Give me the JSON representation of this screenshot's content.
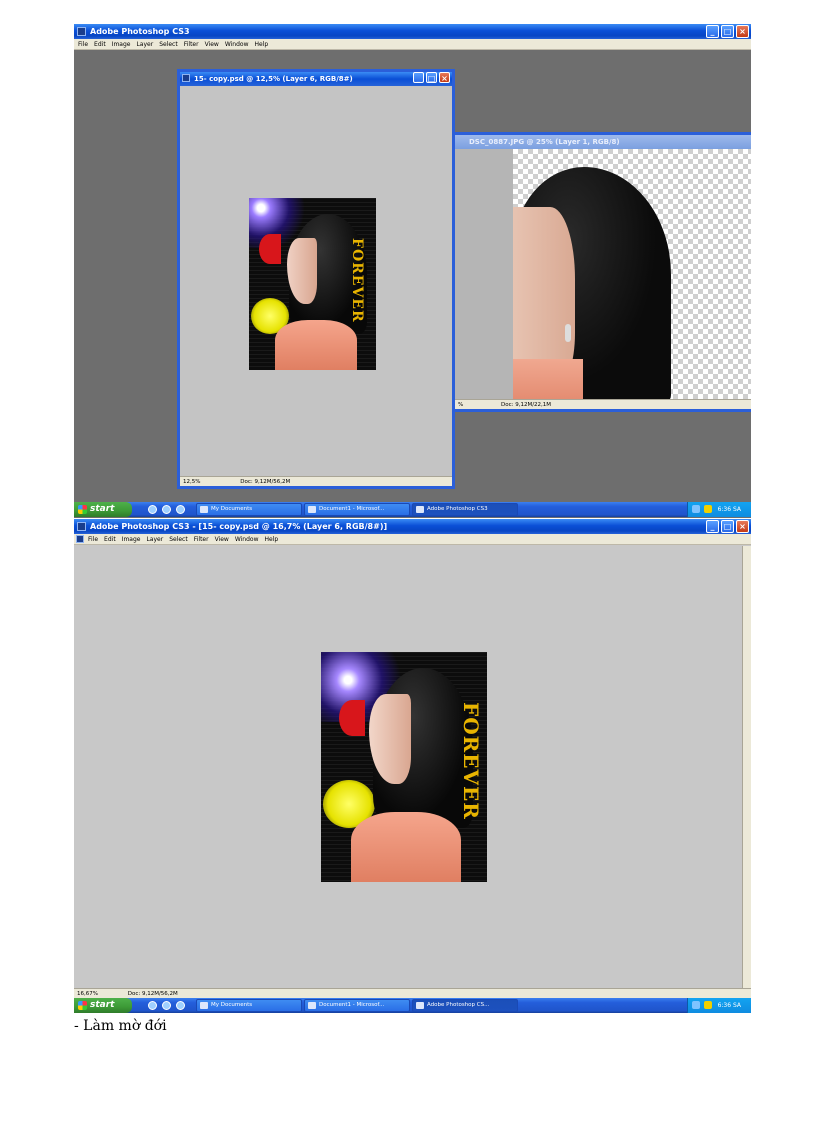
{
  "shot1": {
    "app_title": "Adobe Photoshop CS3",
    "menu": [
      "File",
      "Edit",
      "Image",
      "Layer",
      "Select",
      "Filter",
      "View",
      "Window",
      "Help"
    ],
    "doc_front": {
      "title": "15- copy.psd @ 12,5% (Layer 6, RGB/8#)",
      "zoom": "12,5%",
      "doc_info": "Doc: 9,12M/56,2M"
    },
    "doc_back": {
      "title": "DSC_0887.JPG @ 25% (Layer 1, RGB/8)",
      "zoom": "%",
      "doc_info": "Doc: 9,12M/22,1M"
    },
    "taskbar": {
      "start": "start",
      "tasks": [
        "My Documents",
        "Document1 - Microsof...",
        "Adobe Photoshop CS3"
      ],
      "clock": "6:36 SA"
    }
  },
  "shot2": {
    "app_title": "Adobe Photoshop CS3 - [15- copy.psd @ 16,7% (Layer 6, RGB/8#)]",
    "menu": [
      "File",
      "Edit",
      "Image",
      "Layer",
      "Select",
      "Filter",
      "View",
      "Window",
      "Help"
    ],
    "zoom": "16,67%",
    "doc_info": "Doc: 9,12M/56,2M",
    "taskbar": {
      "start": "start",
      "tasks": [
        "My Documents",
        "Document1 - Microsof...",
        "Adobe Photoshop CS..."
      ],
      "clock": "6:36 SA"
    }
  },
  "artwork_text": "FOREVER",
  "caption": "- Làm mờ đới"
}
